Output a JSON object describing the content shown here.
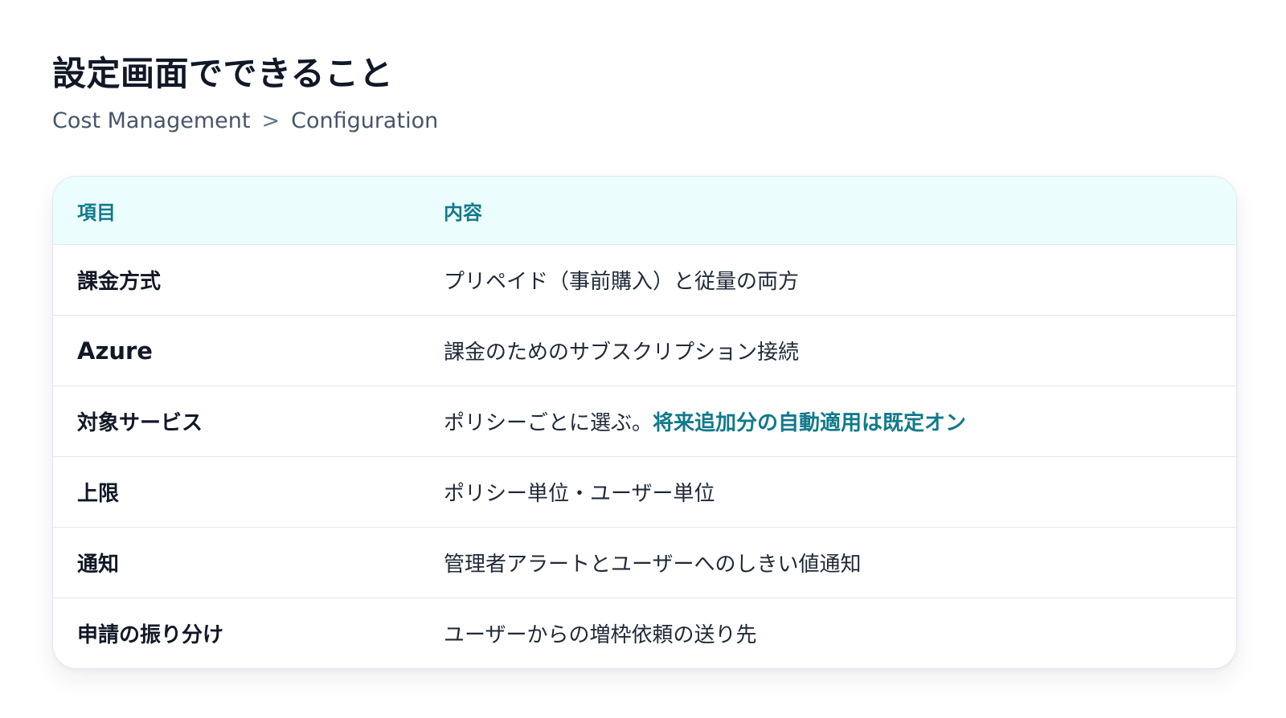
{
  "page": {
    "title": "設定画面でできること",
    "breadcrumb": [
      "Cost Management",
      "Configuration"
    ],
    "breadcrumb_separator": ">"
  },
  "table": {
    "headers": [
      "項目",
      "内容"
    ],
    "rows": [
      {
        "key": "課金方式",
        "value": "プリペイド（事前購入）と従量の両方",
        "highlight": ""
      },
      {
        "key": "Azure",
        "value": "課金のためのサブスクリプション接続",
        "highlight": ""
      },
      {
        "key": "対象サービス",
        "value": "ポリシーごとに選ぶ。",
        "highlight": "将来追加分の自動適用は既定オン"
      },
      {
        "key": "上限",
        "value": "ポリシー単位・ユーザー単位",
        "highlight": ""
      },
      {
        "key": "通知",
        "value": "管理者アラートとユーザーへのしきい値通知",
        "highlight": ""
      },
      {
        "key": "申請の振り分け",
        "value": "ユーザーからの増枠依頼の送り先",
        "highlight": ""
      }
    ]
  },
  "colors": {
    "accent": "#117a8b",
    "header_bg": "#ecfdfe",
    "text": "#111827",
    "muted": "#475569"
  }
}
